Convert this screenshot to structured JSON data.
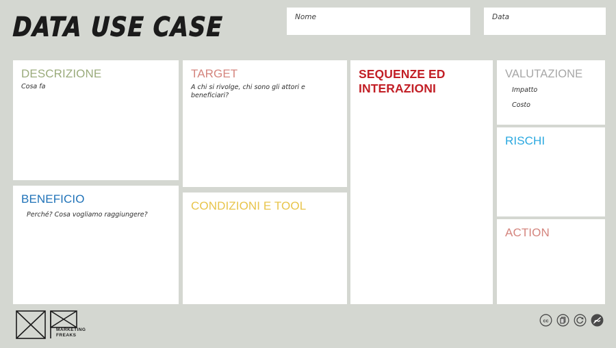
{
  "header": {
    "title": "DATA USE CASE",
    "fields": [
      {
        "name": "nome",
        "label": "Nome",
        "value": ""
      },
      {
        "name": "data",
        "label": "Data",
        "value": ""
      }
    ]
  },
  "board": {
    "cards": [
      {
        "key": "descrizione",
        "heading": "DESCRIZIONE",
        "subtitle": "Cosa fa",
        "color": "#9aab7b",
        "content": ""
      },
      {
        "key": "target",
        "heading": "TARGET",
        "subtitle": "A chi si rivolge, chi sono gli attori e\nbeneficiari?",
        "color": "#d4847d",
        "content": ""
      },
      {
        "key": "sequenze",
        "heading": "SEQUENZE ED\nINTERAZIONI",
        "subtitle": "",
        "color": "#c21f26",
        "content": ""
      },
      {
        "key": "valutazione",
        "heading": "VALUTAZIONE",
        "subtitle": "",
        "color": "#a6a6a6",
        "labels": [
          "Impatto",
          "Costo"
        ],
        "content": ""
      },
      {
        "key": "beneficio",
        "heading": "BENEFICIO",
        "subtitle": "Perché? Cosa vogliamo raggiungere?",
        "color": "#1f72b8",
        "content": ""
      },
      {
        "key": "condizioni",
        "heading": "CONDIZIONI E TOOL",
        "subtitle": "",
        "color": "#e8c44a",
        "content": ""
      },
      {
        "key": "rischi",
        "heading": "RISCHI",
        "subtitle": "",
        "color": "#29a8e0",
        "content": ""
      },
      {
        "key": "action",
        "heading": "ACTION",
        "subtitle": "",
        "color": "#d4847d",
        "content": ""
      }
    ]
  },
  "footer": {
    "logo_name": "MARKETING\nFREAKS",
    "license_icons": [
      "creative-commons-icon",
      "creative-commons-by-icon",
      "creative-commons-sa-icon",
      "creative-commons-nc-icon"
    ]
  },
  "colors": {
    "background": "#d4d7d1",
    "card": "#ffffff",
    "ink": "#1b1b1b"
  }
}
